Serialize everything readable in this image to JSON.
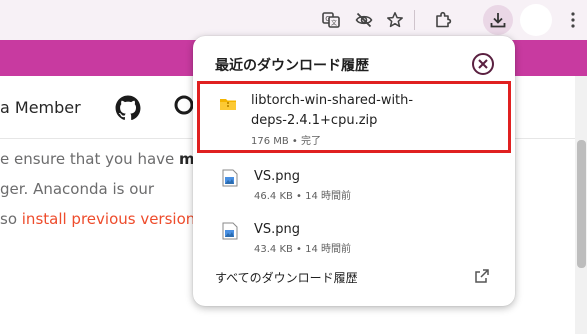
{
  "toolbar": {
    "icons": [
      "translate-icon",
      "eye-off-icon",
      "star-icon",
      "extensions-icon",
      "download-icon",
      "profile-avatar",
      "menu-icon"
    ],
    "active_color": "#ead7e6"
  },
  "page": {
    "banner_color": "#c83aa0",
    "nav": {
      "member_text": "a Member",
      "icons": [
        "github-icon",
        "search-icon"
      ]
    },
    "lines": [
      {
        "pre": "e ensure that you have ",
        "bold": "me",
        "link": ""
      },
      {
        "pre": "ger. Anaconda is our",
        "bold": "",
        "link": ""
      },
      {
        "pre": "so ",
        "bold": "",
        "link": "install previous versions"
      }
    ],
    "link_color": "#ee4c2c"
  },
  "downloads": {
    "title": "最近のダウンロード履歴",
    "items": [
      {
        "name_line1": "libtorch-win-shared-with-",
        "name_line2": "deps-2.4.1+cpu.zip",
        "meta": "176 MB • 完了",
        "icon": "zip-folder-icon"
      },
      {
        "name_line1": "VS.png",
        "meta": "46.4 KB • 14 時間前",
        "icon": "image-file-icon"
      },
      {
        "name_line1": "VS.png",
        "meta": "43.4 KB • 14 時間前",
        "icon": "image-file-icon"
      }
    ],
    "footer": "すべてのダウンロード履歴",
    "highlight_color": "#e02020"
  }
}
